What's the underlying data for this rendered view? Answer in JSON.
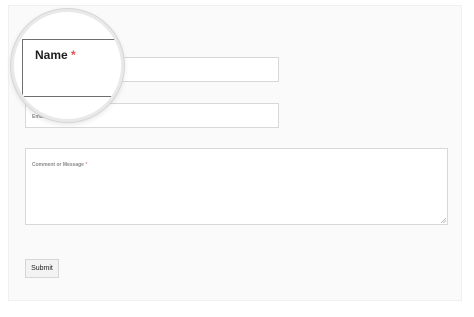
{
  "form": {
    "name_label": "Name",
    "required_marker": "*",
    "email_label": "Email",
    "message_label": "Comment or Message",
    "submit_label": "Submit"
  }
}
